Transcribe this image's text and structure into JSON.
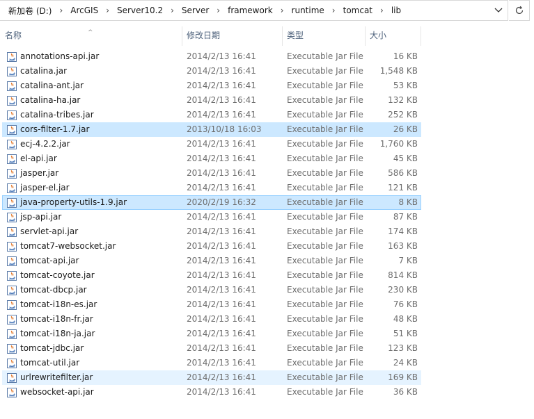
{
  "breadcrumb": [
    "新加卷 (D:)",
    "ArcGIS",
    "Server10.2",
    "Server",
    "framework",
    "runtime",
    "tomcat",
    "lib"
  ],
  "columns": {
    "name": "名称",
    "date": "修改日期",
    "type": "类型",
    "size": "大小"
  },
  "files": [
    {
      "name": "annotations-api.jar",
      "date": "2014/2/13 16:41",
      "type": "Executable Jar File",
      "size": "16 KB",
      "state": ""
    },
    {
      "name": "catalina.jar",
      "date": "2014/2/13 16:41",
      "type": "Executable Jar File",
      "size": "1,548 KB",
      "state": ""
    },
    {
      "name": "catalina-ant.jar",
      "date": "2014/2/13 16:41",
      "type": "Executable Jar File",
      "size": "53 KB",
      "state": ""
    },
    {
      "name": "catalina-ha.jar",
      "date": "2014/2/13 16:41",
      "type": "Executable Jar File",
      "size": "132 KB",
      "state": ""
    },
    {
      "name": "catalina-tribes.jar",
      "date": "2014/2/13 16:41",
      "type": "Executable Jar File",
      "size": "252 KB",
      "state": ""
    },
    {
      "name": "cors-filter-1.7.jar",
      "date": "2013/10/18 16:03",
      "type": "Executable Jar File",
      "size": "26 KB",
      "state": "selected"
    },
    {
      "name": "ecj-4.2.2.jar",
      "date": "2014/2/13 16:41",
      "type": "Executable Jar File",
      "size": "1,760 KB",
      "state": ""
    },
    {
      "name": "el-api.jar",
      "date": "2014/2/13 16:41",
      "type": "Executable Jar File",
      "size": "45 KB",
      "state": ""
    },
    {
      "name": "jasper.jar",
      "date": "2014/2/13 16:41",
      "type": "Executable Jar File",
      "size": "586 KB",
      "state": ""
    },
    {
      "name": "jasper-el.jar",
      "date": "2014/2/13 16:41",
      "type": "Executable Jar File",
      "size": "121 KB",
      "state": ""
    },
    {
      "name": "java-property-utils-1.9.jar",
      "date": "2020/2/19 16:32",
      "type": "Executable Jar File",
      "size": "8 KB",
      "state": "focused"
    },
    {
      "name": "jsp-api.jar",
      "date": "2014/2/13 16:41",
      "type": "Executable Jar File",
      "size": "87 KB",
      "state": ""
    },
    {
      "name": "servlet-api.jar",
      "date": "2014/2/13 16:41",
      "type": "Executable Jar File",
      "size": "174 KB",
      "state": ""
    },
    {
      "name": "tomcat7-websocket.jar",
      "date": "2014/2/13 16:41",
      "type": "Executable Jar File",
      "size": "163 KB",
      "state": ""
    },
    {
      "name": "tomcat-api.jar",
      "date": "2014/2/13 16:41",
      "type": "Executable Jar File",
      "size": "7 KB",
      "state": ""
    },
    {
      "name": "tomcat-coyote.jar",
      "date": "2014/2/13 16:41",
      "type": "Executable Jar File",
      "size": "814 KB",
      "state": ""
    },
    {
      "name": "tomcat-dbcp.jar",
      "date": "2014/2/13 16:41",
      "type": "Executable Jar File",
      "size": "230 KB",
      "state": ""
    },
    {
      "name": "tomcat-i18n-es.jar",
      "date": "2014/2/13 16:41",
      "type": "Executable Jar File",
      "size": "76 KB",
      "state": ""
    },
    {
      "name": "tomcat-i18n-fr.jar",
      "date": "2014/2/13 16:41",
      "type": "Executable Jar File",
      "size": "48 KB",
      "state": ""
    },
    {
      "name": "tomcat-i18n-ja.jar",
      "date": "2014/2/13 16:41",
      "type": "Executable Jar File",
      "size": "51 KB",
      "state": ""
    },
    {
      "name": "tomcat-jdbc.jar",
      "date": "2014/2/13 16:41",
      "type": "Executable Jar File",
      "size": "123 KB",
      "state": ""
    },
    {
      "name": "tomcat-util.jar",
      "date": "2014/2/13 16:41",
      "type": "Executable Jar File",
      "size": "24 KB",
      "state": ""
    },
    {
      "name": "urlrewritefilter.jar",
      "date": "2014/2/13 16:41",
      "type": "Executable Jar File",
      "size": "169 KB",
      "state": "hover"
    },
    {
      "name": "websocket-api.jar",
      "date": "2014/2/13 16:41",
      "type": "Executable Jar File",
      "size": "36 KB",
      "state": ""
    }
  ],
  "icons": {
    "dropdown": "chevron-down-icon",
    "refresh": "refresh-icon",
    "file": "jar-file-icon",
    "sort": "sort-up-icon"
  },
  "colors": {
    "selected_bg": "#cce8ff",
    "focused_border": "#99d1ff",
    "hover_bg": "#e5f3ff",
    "header_text": "#4c607a",
    "secondary_text": "#6d6d6d"
  }
}
